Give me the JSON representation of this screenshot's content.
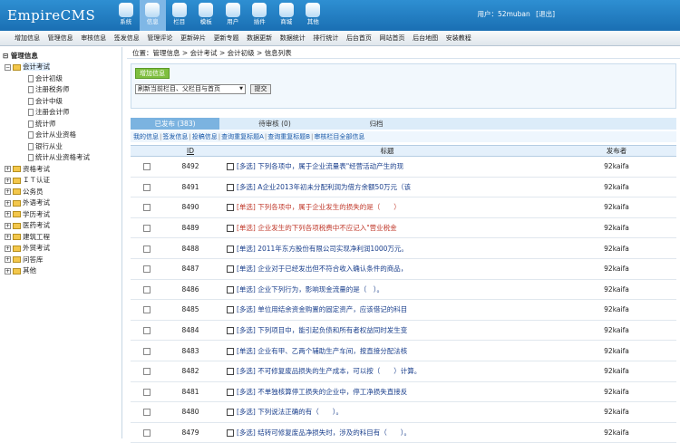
{
  "logo": "EmpireCMS",
  "nav": [
    {
      "label": "系统",
      "icon": "system-icon",
      "active": false
    },
    {
      "label": "信息",
      "icon": "info-icon",
      "active": true
    },
    {
      "label": "栏目",
      "icon": "column-icon",
      "active": false
    },
    {
      "label": "模板",
      "icon": "template-icon",
      "active": false
    },
    {
      "label": "用户",
      "icon": "user-icon",
      "active": false
    },
    {
      "label": "插件",
      "icon": "plugin-icon",
      "active": false
    },
    {
      "label": "商城",
      "icon": "shop-icon",
      "active": false
    },
    {
      "label": "其他",
      "icon": "other-icon",
      "active": false
    }
  ],
  "user": {
    "label": "用户：52muban",
    "logout": "[退出]"
  },
  "menu": [
    "增加信息",
    "管理信息",
    "审核信息",
    "签发信息",
    "管理评论",
    "更新碎片",
    "更新专题",
    "数据更新",
    "数据统计",
    "排行统计",
    "后台首页",
    "网站首页",
    "后台地图",
    "安装教程"
  ],
  "tree": {
    "root": "管理信息",
    "nodes": [
      {
        "label": "会计考试",
        "level": 1,
        "open": true,
        "selected": true,
        "kind": "folder"
      },
      {
        "label": "会计初级",
        "level": 2,
        "kind": "doc"
      },
      {
        "label": "注册税务师",
        "level": 2,
        "kind": "doc"
      },
      {
        "label": "会计中级",
        "level": 2,
        "kind": "doc"
      },
      {
        "label": "注册会计师",
        "level": 2,
        "kind": "doc"
      },
      {
        "label": "统计师",
        "level": 2,
        "kind": "doc"
      },
      {
        "label": "会计从业资格",
        "level": 2,
        "kind": "doc"
      },
      {
        "label": "银行从业",
        "level": 2,
        "kind": "doc"
      },
      {
        "label": "统计从业资格考试",
        "level": 2,
        "kind": "doc"
      },
      {
        "label": "资格考试",
        "level": 1,
        "kind": "folder"
      },
      {
        "label": "ＩＴ认证",
        "level": 1,
        "kind": "folder"
      },
      {
        "label": "公务员",
        "level": 1,
        "kind": "folder"
      },
      {
        "label": "外语考试",
        "level": 1,
        "kind": "folder"
      },
      {
        "label": "学历考试",
        "level": 1,
        "kind": "folder"
      },
      {
        "label": "医药考试",
        "level": 1,
        "kind": "folder"
      },
      {
        "label": "建筑工程",
        "level": 1,
        "kind": "folder"
      },
      {
        "label": "外贸考试",
        "level": 1,
        "kind": "folder"
      },
      {
        "label": "问答库",
        "level": 1,
        "kind": "folder"
      },
      {
        "label": "其他",
        "level": 1,
        "kind": "folder"
      }
    ]
  },
  "crumb": {
    "label": "位置：",
    "items": [
      "管理信息",
      "会计考试",
      "会计初级",
      "信息列表"
    ]
  },
  "actions": {
    "add": "增加信息",
    "select": "刷新当前栏目、父栏目与首页",
    "submit": "提交"
  },
  "tabs": [
    {
      "label": "已发布 (383)",
      "active": true
    },
    {
      "label": "待审核 (0)",
      "active": false
    },
    {
      "label": "归档",
      "active": false
    }
  ],
  "links": [
    "我的信息",
    "签发信息",
    "投稿信息",
    "查询重复标题A",
    "查询重复标题B",
    "审核栏目全部信息"
  ],
  "table": {
    "headers": {
      "id": "ID",
      "title": "标题",
      "author": "发布者"
    },
    "rows": [
      {
        "id": "8492",
        "title": "[多选] 下列各项中，属于企业流量表\"经营活动产生的现",
        "author": "92kaifa",
        "red": false
      },
      {
        "id": "8491",
        "title": "[多选] A企业2013年初未分配利润为借方余额50万元（该",
        "author": "92kaifa",
        "red": false
      },
      {
        "id": "8490",
        "title": "[单选] 下列各项中，属于企业发生的损失的是（　　）",
        "author": "92kaifa",
        "red": true
      },
      {
        "id": "8489",
        "title": "[单选] 企业发生的下列各项税费中不应记入\"营业税金",
        "author": "92kaifa",
        "red": true
      },
      {
        "id": "8488",
        "title": "[单选] 2011年东方股份有限公司实现净利润1000万元。",
        "author": "92kaifa",
        "red": false
      },
      {
        "id": "8487",
        "title": "[单选] 企业对于已经发出但不符合收入确认条件的商品，",
        "author": "92kaifa",
        "red": false
      },
      {
        "id": "8486",
        "title": "[单选] 企业下列行为，影响现金流量的是（　）。",
        "author": "92kaifa",
        "red": false
      },
      {
        "id": "8485",
        "title": "[多选] 单位用结余资金购置的固定资产，应该借记的科目",
        "author": "92kaifa",
        "red": false
      },
      {
        "id": "8484",
        "title": "[多选] 下列项目中，能引起负债和所有者权益同时发生变",
        "author": "92kaifa",
        "red": false
      },
      {
        "id": "8483",
        "title": "[单选] 企业有甲、乙两个辅助生产车间，按直接分配法核",
        "author": "92kaifa",
        "red": false
      },
      {
        "id": "8482",
        "title": "[多选] 不可修复废品损失的生产成本，可以按（　　）计算。",
        "author": "92kaifa",
        "red": false
      },
      {
        "id": "8481",
        "title": "[多选] 不单独核算停工损失的企业中，停工净损失直接反",
        "author": "92kaifa",
        "red": false
      },
      {
        "id": "8480",
        "title": "[多选] 下列说法正确的有（　　）。",
        "author": "92kaifa",
        "red": false
      },
      {
        "id": "8479",
        "title": "[多选] 结转可修复废品净损失时，涉及的科目有（　　）。",
        "author": "92kaifa",
        "red": false
      }
    ]
  }
}
